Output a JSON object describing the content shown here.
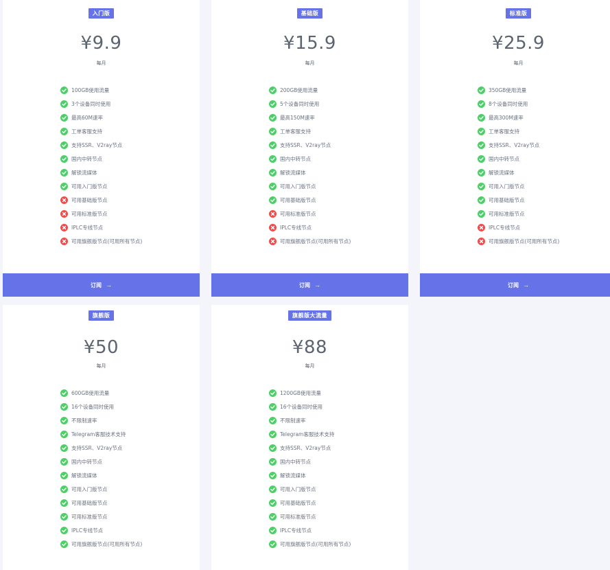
{
  "plans": [
    {
      "badge": "入门版",
      "price": "¥9.9",
      "period": "每月",
      "button": "订阅",
      "features": [
        {
          "text": "100GB使用流量",
          "included": true
        },
        {
          "text": "3个设备同时使用",
          "included": true
        },
        {
          "text": "最高60M速率",
          "included": true
        },
        {
          "text": "工单客服支持",
          "included": true
        },
        {
          "text": "支持SSR、V2ray节点",
          "included": true
        },
        {
          "text": "国内中转节点",
          "included": true
        },
        {
          "text": "解锁流媒体",
          "included": true
        },
        {
          "text": "可用入门版节点",
          "included": true
        },
        {
          "text": "可用基础版节点",
          "included": false
        },
        {
          "text": "可用标准版节点",
          "included": false
        },
        {
          "text": "IPLC专线节点",
          "included": false
        },
        {
          "text": "可用旗舰版节点(可用所有节点)",
          "included": false
        }
      ]
    },
    {
      "badge": "基础版",
      "price": "¥15.9",
      "period": "每月",
      "button": "订阅",
      "features": [
        {
          "text": "200GB使用流量",
          "included": true
        },
        {
          "text": "5个设备同时使用",
          "included": true
        },
        {
          "text": "最高150M速率",
          "included": true
        },
        {
          "text": "工单客服支持",
          "included": true
        },
        {
          "text": "支持SSR、V2ray节点",
          "included": true
        },
        {
          "text": "国内中转节点",
          "included": true
        },
        {
          "text": "解锁流媒体",
          "included": true
        },
        {
          "text": "可用入门版节点",
          "included": true
        },
        {
          "text": "可用基础版节点",
          "included": true
        },
        {
          "text": "可用标准版节点",
          "included": false
        },
        {
          "text": "IPLC专线节点",
          "included": false
        },
        {
          "text": "可用旗舰版节点(可用所有节点)",
          "included": false
        }
      ]
    },
    {
      "badge": "标准版",
      "price": "¥25.9",
      "period": "每月",
      "button": "订阅",
      "features": [
        {
          "text": "350GB使用流量",
          "included": true
        },
        {
          "text": "8个设备同时使用",
          "included": true
        },
        {
          "text": "最高300M速率",
          "included": true
        },
        {
          "text": "工单客服支持",
          "included": true
        },
        {
          "text": "支持SSR、V2ray节点",
          "included": true
        },
        {
          "text": "国内中转节点",
          "included": true
        },
        {
          "text": "解锁流媒体",
          "included": true
        },
        {
          "text": "可用入门版节点",
          "included": true
        },
        {
          "text": "可用基础版节点",
          "included": true
        },
        {
          "text": "可用标准版节点",
          "included": true
        },
        {
          "text": "IPLC专线节点",
          "included": false
        },
        {
          "text": "可用旗舰版节点(可用所有节点)",
          "included": false
        }
      ]
    },
    {
      "badge": "旗舰版",
      "price": "¥50",
      "period": "每月",
      "features": [
        {
          "text": "600GB使用流量",
          "included": true
        },
        {
          "text": "16个设备同时使用",
          "included": true
        },
        {
          "text": "不限制速率",
          "included": true
        },
        {
          "text": "Telegram客服技术支持",
          "included": true
        },
        {
          "text": "支持SSR、V2ray节点",
          "included": true
        },
        {
          "text": "国内中转节点",
          "included": true
        },
        {
          "text": "解锁流媒体",
          "included": true
        },
        {
          "text": "可用入门版节点",
          "included": true
        },
        {
          "text": "可用基础版节点",
          "included": true
        },
        {
          "text": "可用标准版节点",
          "included": true
        },
        {
          "text": "IPLC专线节点",
          "included": true
        },
        {
          "text": "可用旗舰版节点(可用所有节点)",
          "included": true
        }
      ]
    },
    {
      "badge": "旗舰版大流量",
      "price": "¥88",
      "period": "每月",
      "features": [
        {
          "text": "1200GB使用流量",
          "included": true
        },
        {
          "text": "16个设备同时使用",
          "included": true
        },
        {
          "text": "不限制速率",
          "included": true
        },
        {
          "text": "Telegram客服技术支持",
          "included": true
        },
        {
          "text": "支持SSR、V2ray节点",
          "included": true
        },
        {
          "text": "国内中转节点",
          "included": true
        },
        {
          "text": "解锁流媒体",
          "included": true
        },
        {
          "text": "可用入门版节点",
          "included": true
        },
        {
          "text": "可用基础版节点",
          "included": true
        },
        {
          "text": "可用标准版节点",
          "included": true
        },
        {
          "text": "IPLC专线节点",
          "included": true
        },
        {
          "text": "可用旗舰版节点(可用所有节点)",
          "included": true
        }
      ]
    }
  ],
  "colors": {
    "accent": "#6673e8",
    "check": "#4ccf66",
    "cross": "#ee4d4d",
    "background": "#f4f5fa"
  }
}
